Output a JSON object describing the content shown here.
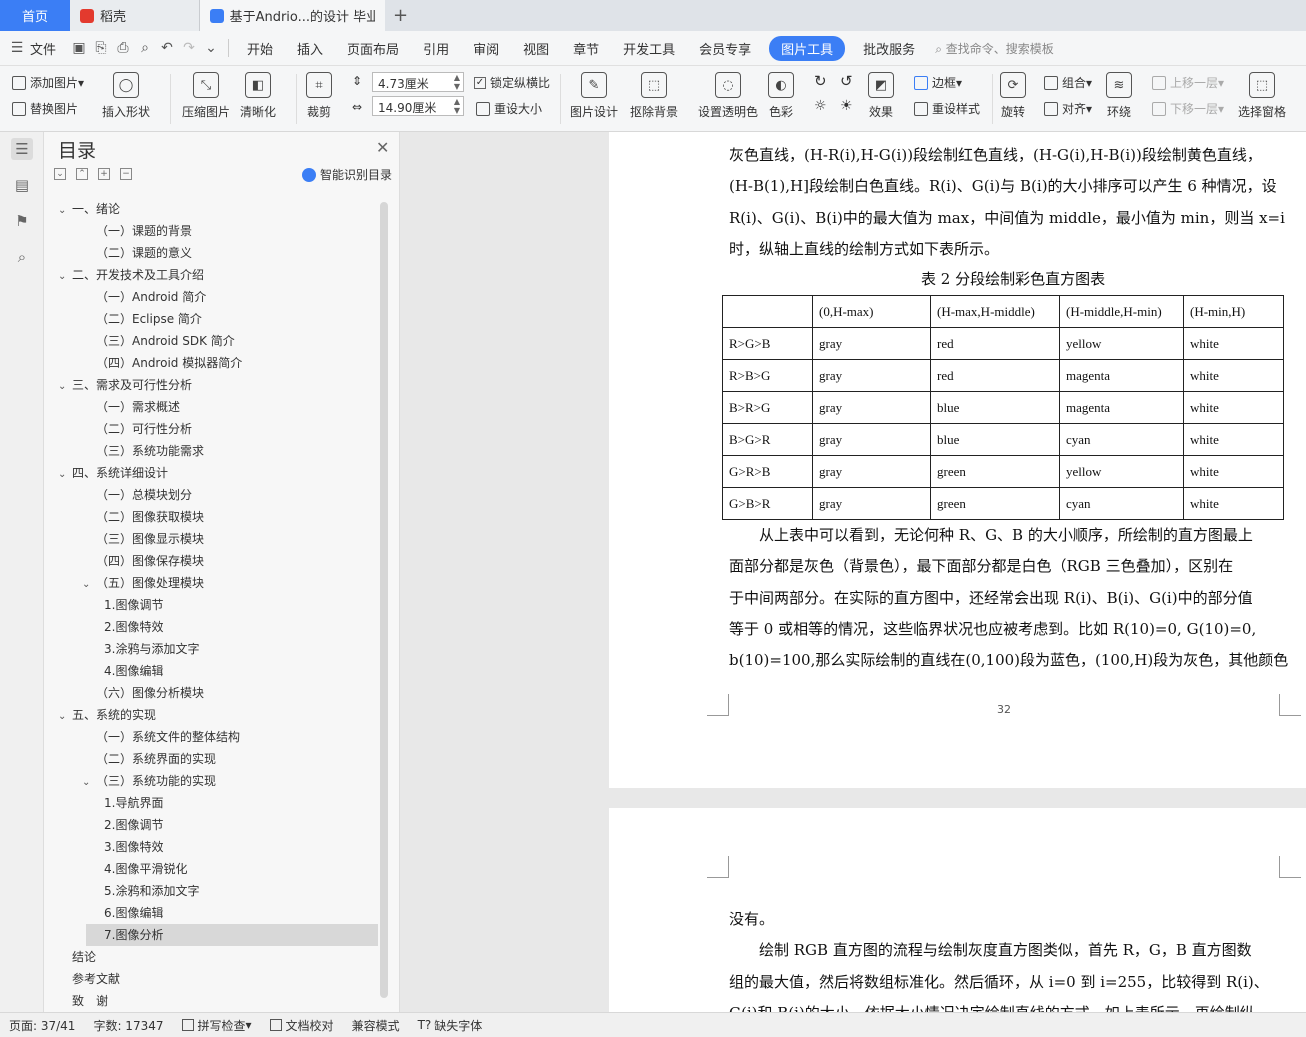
{
  "tabs": {
    "home": "首页",
    "tab1": "稻壳",
    "tab2": "基于Andrio...的设计 毕业论文",
    "add": "+"
  },
  "menu": {
    "file": "文件",
    "items": [
      "开始",
      "插入",
      "页面布局",
      "引用",
      "审阅",
      "视图",
      "章节",
      "开发工具",
      "会员专享"
    ],
    "active": "图片工具",
    "after": "批改服务",
    "search": "查找命令、搜索模板"
  },
  "ribbon": {
    "add_image": "添加图片",
    "replace_image": "替换图片",
    "insert_shape": "插入形状",
    "compress": "压缩图片",
    "sharpen": "清晰化",
    "crop": "裁剪",
    "width": "4.73厘米",
    "height": "14.90厘米",
    "lock_ratio": "锁定纵横比",
    "reset_size": "重设大小",
    "design": "图片设计",
    "remove_bg": "抠除背景",
    "set_transparent": "设置透明色",
    "color": "色彩",
    "effects": "效果",
    "border": "边框",
    "reset_style": "重设样式",
    "rotate": "旋转",
    "group": "组合",
    "align": "对齐",
    "wrap": "环绕",
    "bring_forward": "上移一层",
    "send_backward": "下移一层",
    "selection_pane": "选择窗格"
  },
  "toc": {
    "title": "目录",
    "smart": "智能识别目录",
    "items": [
      {
        "text": "一、绪论",
        "level": 1,
        "caret": "⌄"
      },
      {
        "text": "（一）课题的背景",
        "level": 2
      },
      {
        "text": "（二）课题的意义",
        "level": 2
      },
      {
        "text": "二、开发技术及工具介绍",
        "level": 1,
        "caret": "⌄"
      },
      {
        "text": "（一）Android 简介",
        "level": 2
      },
      {
        "text": "（二）Eclipse 简介",
        "level": 2
      },
      {
        "text": "（三）Android SDK 简介",
        "level": 2
      },
      {
        "text": "（四）Android 模拟器简介",
        "level": 2
      },
      {
        "text": "三、需求及可行性分析",
        "level": 1,
        "caret": "⌄"
      },
      {
        "text": "（一）需求概述",
        "level": 2
      },
      {
        "text": "（二）可行性分析",
        "level": 2
      },
      {
        "text": "（三）系统功能需求",
        "level": 2
      },
      {
        "text": "四、系统详细设计",
        "level": 1,
        "caret": "⌄"
      },
      {
        "text": "（一）总模块划分",
        "level": 2
      },
      {
        "text": "（二）图像获取模块",
        "level": 2
      },
      {
        "text": "（三）图像显示模块",
        "level": 2
      },
      {
        "text": "（四）图像保存模块",
        "level": 2
      },
      {
        "text": "（五）图像处理模块",
        "level": 2,
        "caret": "⌄"
      },
      {
        "text": "1.图像调节",
        "level": 3
      },
      {
        "text": "2.图像特效",
        "level": 3
      },
      {
        "text": "3.涂鸦与添加文字",
        "level": 3
      },
      {
        "text": "4.图像编辑",
        "level": 3
      },
      {
        "text": "（六）图像分析模块",
        "level": 2
      },
      {
        "text": "五、系统的实现",
        "level": 1,
        "caret": "⌄"
      },
      {
        "text": "（一）系统文件的整体结构",
        "level": 2
      },
      {
        "text": "（二）系统界面的实现",
        "level": 2
      },
      {
        "text": "（三）系统功能的实现",
        "level": 2,
        "caret": "⌄"
      },
      {
        "text": "1.导航界面",
        "level": 3
      },
      {
        "text": "2.图像调节",
        "level": 3
      },
      {
        "text": "3.图像特效",
        "level": 3
      },
      {
        "text": "4.图像平滑锐化",
        "level": 3
      },
      {
        "text": "5.涂鸦和添加文字",
        "level": 3
      },
      {
        "text": "6.图像编辑",
        "level": 3
      },
      {
        "text": "7.图像分析",
        "level": 3,
        "selected": true
      },
      {
        "text": "结论",
        "level": 0
      },
      {
        "text": "参考文献",
        "level": 0
      },
      {
        "text": "致　谢",
        "level": 0
      }
    ]
  },
  "doc": {
    "page1_lines": [
      "灰色直线，(H-R(i),H-G(i))段绘制红色直线，(H-G(i),H-B(i))段绘制黄色直线，",
      "(H-B(1),H]段绘制白色直线。R(i)、G(i)与 B(i)的大小排序可以产生 6 种情况，设",
      "R(i)、G(i)、B(i)中的最大值为 max，中间值为 middle，最小值为 min，则当 x=i",
      "时，纵轴上直线的绘制方式如下表所示。"
    ],
    "caption": "表 2 分段绘制彩色直方图表",
    "table_header": [
      "",
      "(0,H-max)",
      "(H-max,H-middle)",
      "(H-middle,H-min)",
      "(H-min,H)"
    ],
    "table_rows": [
      [
        "R>G>B",
        "gray",
        "red",
        "yellow",
        "white"
      ],
      [
        "R>B>G",
        "gray",
        "red",
        "magenta",
        "white"
      ],
      [
        "B>R>G",
        "gray",
        "blue",
        "magenta",
        "white"
      ],
      [
        "B>G>R",
        "gray",
        "blue",
        "cyan",
        "white"
      ],
      [
        "G>R>B",
        "gray",
        "green",
        "yellow",
        "white"
      ],
      [
        "G>B>R",
        "gray",
        "green",
        "cyan",
        "white"
      ]
    ],
    "page1_after": [
      "　　从上表中可以看到，无论何种 R、G、B 的大小顺序，所绘制的直方图最上",
      "面部分都是灰色（背景色），最下面部分都是白色（RGB 三色叠加），区别在",
      "于中间两部分。在实际的直方图中，还经常会出现 R(i)、B(i)、G(i)中的部分值",
      "等于 0 或相等的情况，这些临界状况也应被考虑到。比如 R(10)=0, G(10)=0,",
      "b(10)=100,那么实际绘制的直线在(0,100)段为蓝色，(100,H)段为灰色，其他颜色"
    ],
    "page_number": "32",
    "page2_lines": [
      "没有。",
      "　　绘制 RGB 直方图的流程与绘制灰度直方图类似，首先 R，G，B 直方图数",
      "组的最大值，然后将数组标准化。然后循环，从 i=0 到 i=255，比较得到 R(i)、",
      "G(i)和 B(i)的大小，依据大小情况决定绘制直线的方式，如上表所示。再绘制纵"
    ]
  },
  "status": {
    "page": "页面: 37/41",
    "words": "字数: 17347",
    "spell": "拼写检查",
    "proof": "文档校对",
    "compat": "兼容模式",
    "missing_font": "缺失字体"
  },
  "colors": {
    "accent": "#3b7ef5",
    "tab_bg": "#dfe3e8",
    "wps_red": "#e33a2e"
  }
}
